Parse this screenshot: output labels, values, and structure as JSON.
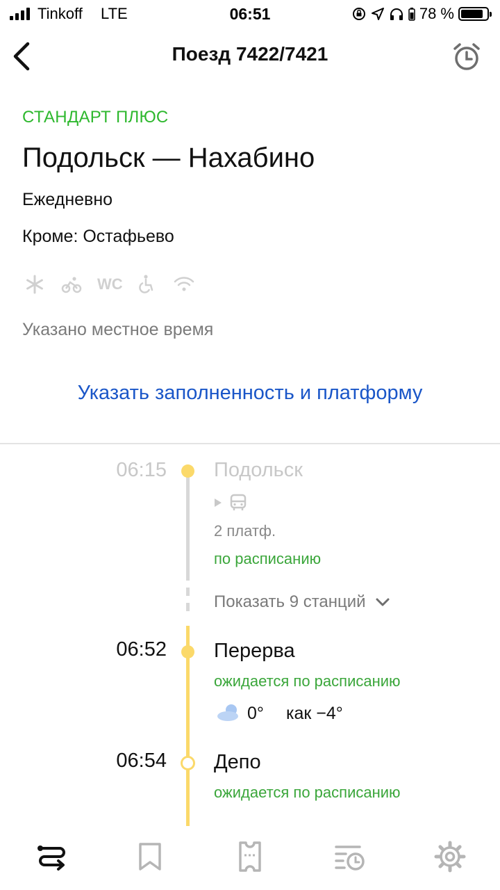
{
  "status_bar": {
    "carrier": "Tinkoff",
    "network": "LTE",
    "time": "06:51",
    "battery": "78 %",
    "battery_level": 0.78
  },
  "nav": {
    "title": "Поезд 7422/7421",
    "back_icon": "chevron-left-icon",
    "alarm_icon": "alarm-clock-icon"
  },
  "train": {
    "type": "СТАНДАРТ ПЛЮС",
    "route": "Подольск — Нахабино",
    "days": "Ежедневно",
    "except": "Кроме: Остафьево",
    "amenities": [
      "snowflake-icon",
      "bicycle-icon",
      "wc-icon",
      "wheelchair-icon",
      "wifi-icon"
    ],
    "wc_label": "WC",
    "local_time_note": "Указано местное время",
    "fill_link": "Указать заполненность и платформу"
  },
  "stops": {
    "first": {
      "time": "06:15",
      "station": "Подольск",
      "platform": "2 платф.",
      "status": "по расписанию"
    },
    "show_more": "Показать 9 станций",
    "perverva": {
      "time": "06:52",
      "station": "Перерва",
      "status": "ожидается по расписанию",
      "temp": "0°",
      "feels": "как −4°"
    },
    "depo": {
      "time": "06:54",
      "station": "Депо",
      "status": "ожидается по расписанию"
    }
  },
  "tabbar": [
    "routes-icon",
    "bookmark-icon",
    "ticket-icon",
    "history-icon",
    "settings-icon"
  ],
  "colors": {
    "accent_green": "#2eb82e",
    "link_blue": "#1a56c8",
    "timeline_yellow": "#fbd96a"
  }
}
